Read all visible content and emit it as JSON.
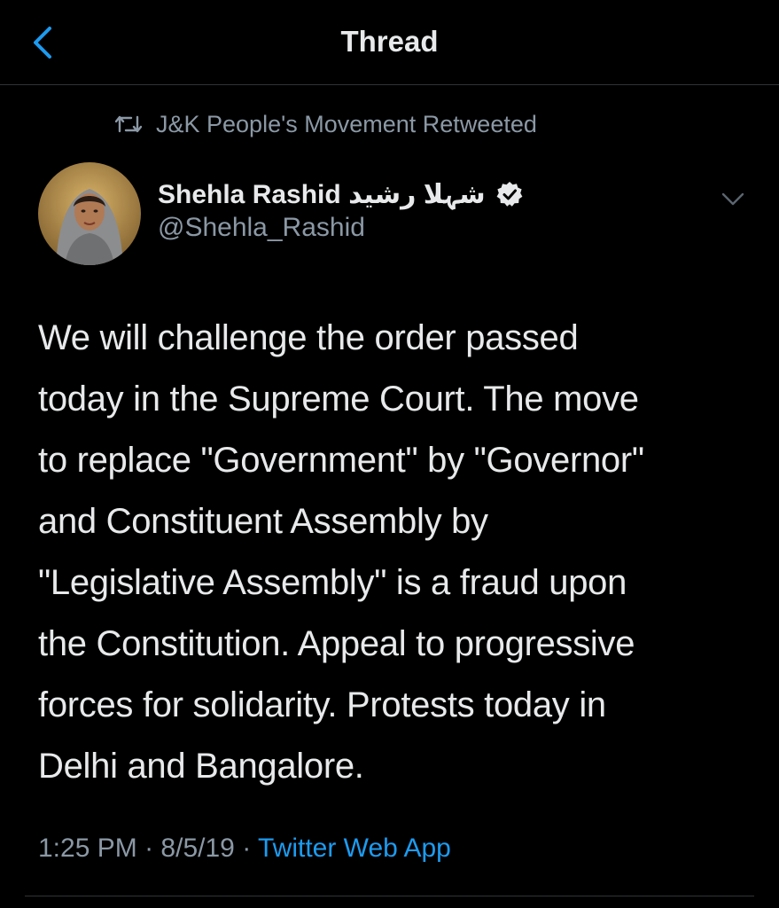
{
  "nav": {
    "back_icon": "back-arrow-icon",
    "title": "Thread"
  },
  "retweet": {
    "icon": "retweet-icon",
    "text": "J&K People's Movement Retweeted"
  },
  "author": {
    "avatar": "avatar",
    "name": "Shehla Rashid شہلا رشید",
    "handle": "@Shehla_Rashid",
    "verified_icon": "verified-badge-icon"
  },
  "menu_icon": "chevron-down-icon",
  "tweet": {
    "lines": [
      "We will challenge the order passed",
      "today in the Supreme Court. The move",
      "to replace \"Government\" by \"Governor\"",
      "and Constituent Assembly by",
      "\"Legislative Assembly\" is a fraud upon",
      "the Constitution. Appeal to progressive",
      "forces for solidarity. Protests today in",
      "Delhi and Bangalore."
    ]
  },
  "meta": {
    "time": "1:25 PM",
    "separator": "·",
    "date": "8/5/19",
    "source": "Twitter Web App"
  },
  "colors": {
    "background": "#000000",
    "accent": "#1d9bf0",
    "secondary_text": "#8b98a5",
    "primary_text": "#e7e9ea"
  }
}
